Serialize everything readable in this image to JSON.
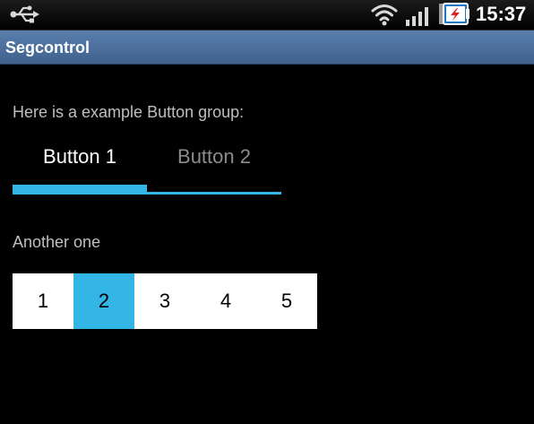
{
  "status_bar": {
    "time": "15:37",
    "icons": [
      "usb-icon",
      "wifi-icon",
      "signal-icon",
      "battery-charging-icon"
    ]
  },
  "app": {
    "title": "Segcontrol"
  },
  "section1": {
    "label": "Here is a example Button group:",
    "buttons": [
      {
        "label": "Button 1",
        "selected": true
      },
      {
        "label": "Button 2",
        "selected": false
      }
    ]
  },
  "section2": {
    "label": "Another one",
    "segments": [
      {
        "label": "1",
        "selected": false
      },
      {
        "label": "2",
        "selected": true
      },
      {
        "label": "3",
        "selected": false
      },
      {
        "label": "4",
        "selected": false
      },
      {
        "label": "5",
        "selected": false
      }
    ]
  },
  "colors": {
    "accent": "#33b5e5",
    "title_bar": "#4a6f9c",
    "background": "#000000"
  }
}
